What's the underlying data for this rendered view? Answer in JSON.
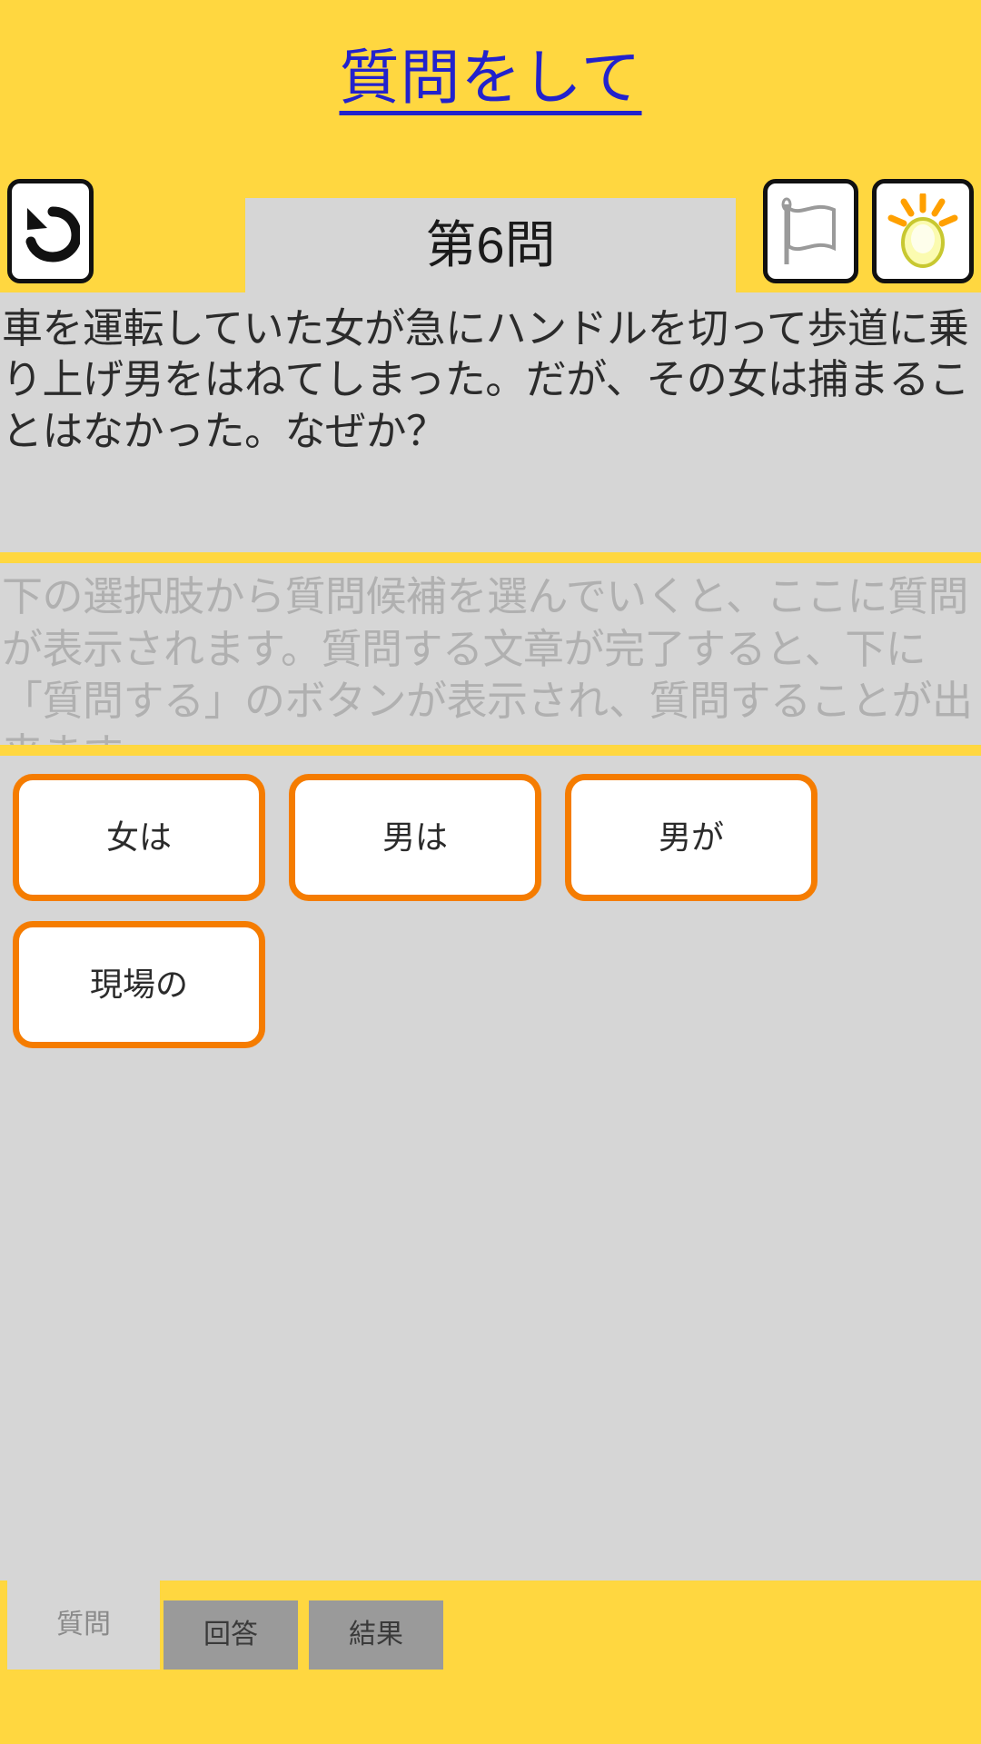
{
  "header": {
    "title": "質問をして"
  },
  "toolbar": {
    "undo_icon": "undo-arrow-icon",
    "question_number": "第6問",
    "flag_icon": "flag-icon",
    "hint_icon": "lightbulb-icon"
  },
  "question": {
    "text": "車を運転していた女が急にハンドルを切って歩道に乗り上げ男をはねてしまった。だが、その女は捕まることはなかった。なぜか？"
  },
  "compose": {
    "placeholder": "下の選択肢から質問候補を選んでいくと、ここに質問が表示されます。質問する文章が完了すると、下に「質問する」のボタンが表示され、質問することが出来ます。"
  },
  "choices": [
    {
      "label": "女は"
    },
    {
      "label": "男は"
    },
    {
      "label": "男が"
    },
    {
      "label": "現場の"
    }
  ],
  "tabs": [
    {
      "label": "質問",
      "active": true
    },
    {
      "label": "回答",
      "active": false
    },
    {
      "label": "結果",
      "active": false
    }
  ],
  "colors": {
    "accent_yellow": "#ffd740",
    "panel_gray": "#d6d6d6",
    "choice_border_orange": "#f57c00",
    "title_blue": "#2222cc",
    "tab_inactive_gray": "#9a9a9a",
    "placeholder_gray": "#b0b0b0"
  }
}
